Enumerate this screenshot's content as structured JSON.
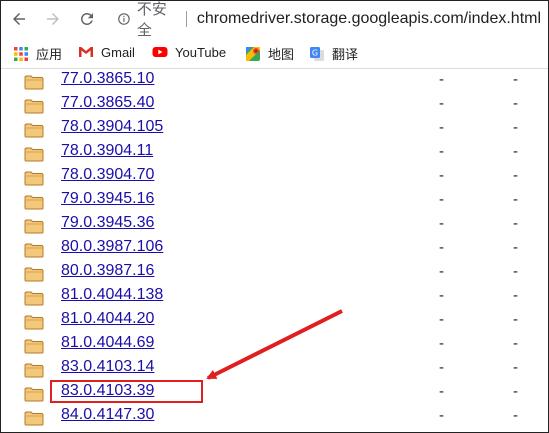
{
  "toolbar": {
    "security_label": "不安全",
    "url": "chromedriver.storage.googleapis.com/index.html"
  },
  "bookmarks": [
    {
      "label": "应用",
      "icon": "apps-grid-icon"
    },
    {
      "label": "Gmail",
      "icon": "gmail-icon"
    },
    {
      "label": "YouTube",
      "icon": "youtube-icon"
    },
    {
      "label": "地图",
      "icon": "maps-icon"
    },
    {
      "label": "翻译",
      "icon": "translate-icon"
    }
  ],
  "listing": {
    "rows": [
      {
        "name": "77.0.3865.10",
        "col1": "-",
        "col2": "-"
      },
      {
        "name": "77.0.3865.40",
        "col1": "-",
        "col2": "-"
      },
      {
        "name": "78.0.3904.105",
        "col1": "-",
        "col2": "-"
      },
      {
        "name": "78.0.3904.11",
        "col1": "-",
        "col2": "-"
      },
      {
        "name": "78.0.3904.70",
        "col1": "-",
        "col2": "-"
      },
      {
        "name": "79.0.3945.16",
        "col1": "-",
        "col2": "-"
      },
      {
        "name": "79.0.3945.36",
        "col1": "-",
        "col2": "-"
      },
      {
        "name": "80.0.3987.106",
        "col1": "-",
        "col2": "-"
      },
      {
        "name": "80.0.3987.16",
        "col1": "-",
        "col2": "-"
      },
      {
        "name": "81.0.4044.138",
        "col1": "-",
        "col2": "-"
      },
      {
        "name": "81.0.4044.20",
        "col1": "-",
        "col2": "-"
      },
      {
        "name": "81.0.4044.69",
        "col1": "-",
        "col2": "-"
      },
      {
        "name": "83.0.4103.14",
        "col1": "-",
        "col2": "-"
      },
      {
        "name": "83.0.4103.39",
        "col1": "-",
        "col2": "-"
      },
      {
        "name": "84.0.4147.30",
        "col1": "-",
        "col2": "-"
      }
    ]
  },
  "annotation": {
    "highlighted_item": "83.0.4103.39",
    "color": "#e02020"
  }
}
